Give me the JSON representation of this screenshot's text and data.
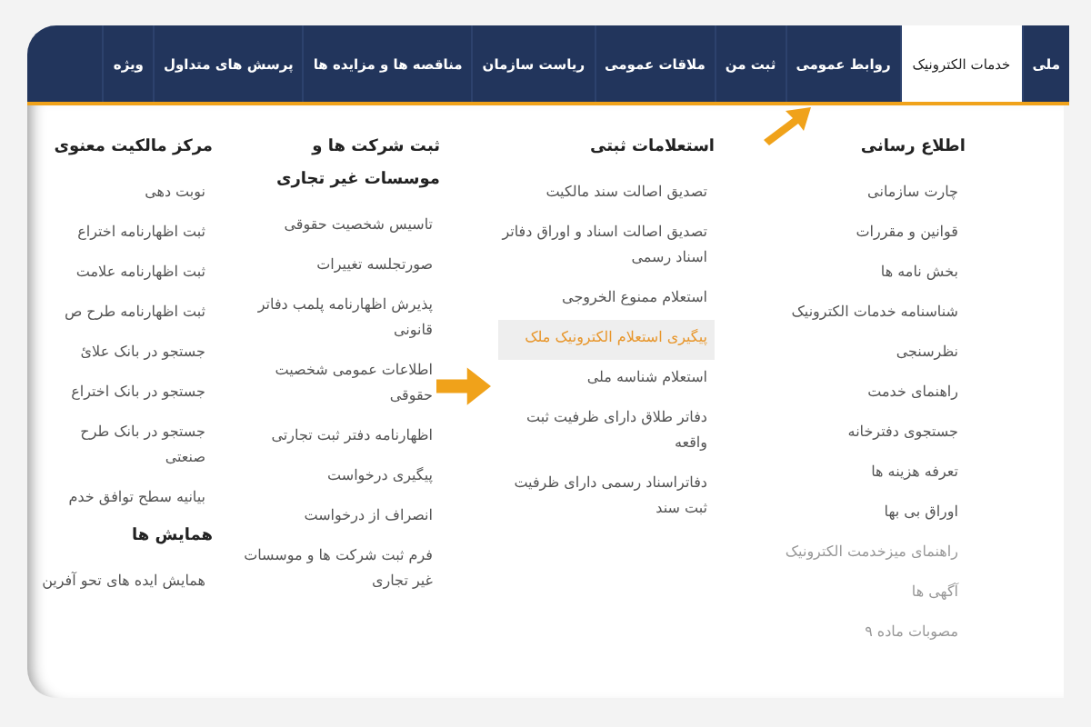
{
  "nav": {
    "items": [
      {
        "label": "ملی",
        "selected": false
      },
      {
        "label": "خدمات الکترونیک",
        "selected": true
      },
      {
        "label": "روابط عمومی",
        "selected": false
      },
      {
        "label": "ثبت من",
        "selected": false
      },
      {
        "label": "ملاقات عمومی",
        "selected": false
      },
      {
        "label": "ریاست سازمان",
        "selected": false
      },
      {
        "label": "مناقصه ها و مزایده ها",
        "selected": false
      },
      {
        "label": "پرسش های متداول",
        "selected": false
      },
      {
        "label": "ویژه",
        "selected": false
      }
    ]
  },
  "menu": {
    "columns": [
      {
        "sections": [
          {
            "heading": "اطلاع رسانی",
            "items": [
              {
                "label": "چارت سازمانی",
                "selected": false
              },
              {
                "label": "قوانین و مقررات",
                "selected": false
              },
              {
                "label": "بخش نامه ها",
                "selected": false
              },
              {
                "label": "شناسنامه خدمات الکترونیک",
                "selected": false
              },
              {
                "label": "نظرسنجی",
                "selected": false
              },
              {
                "label": "راهنمای خدمت",
                "selected": false
              },
              {
                "label": "جستجوی دفترخانه",
                "selected": false
              },
              {
                "label": "تعرفه هزینه ها",
                "selected": false
              },
              {
                "label": "اوراق بی بها",
                "selected": false
              },
              {
                "label": "راهنمای میزخدمت الکترونیک",
                "selected": false
              },
              {
                "label": "آگهی ها",
                "selected": false
              },
              {
                "label": "مصوبات ماده ۹",
                "selected": false
              }
            ]
          }
        ]
      },
      {
        "sections": [
          {
            "heading": "استعلامات ثبتی",
            "items": [
              {
                "label": "تصدیق اصالت سند مالکیت",
                "selected": false
              },
              {
                "label": "تصدیق اصالت اسناد و اوراق دفاتر اسناد رسمی",
                "selected": false
              },
              {
                "label": "استعلام ممنوع الخروجی",
                "selected": false
              },
              {
                "label": "پیگیری استعلام الکترونیک ملک",
                "selected": true
              },
              {
                "label": "استعلام شناسه ملی",
                "selected": false
              },
              {
                "label": "دفاتر طلاق دارای ظرفیت ثبت واقعه",
                "selected": false
              },
              {
                "label": "دفاتراسناد رسمی دارای ظرفیت ثبت سند",
                "selected": false
              }
            ]
          }
        ]
      },
      {
        "sections": [
          {
            "heading": "ثبت شرکت ها و موسسات غیر تجاری",
            "items": [
              {
                "label": "تاسیس شخصیت حقوقی",
                "selected": false
              },
              {
                "label": "صورتجلسه تغییرات",
                "selected": false
              },
              {
                "label": "پذیرش اظهارنامه پلمب دفاتر قانونی",
                "selected": false
              },
              {
                "label": "اطلاعات عمومی شخصیت حقوقی",
                "selected": false
              },
              {
                "label": "اظهارنامه دفتر ثبت تجارتی",
                "selected": false
              },
              {
                "label": "پیگیری درخواست",
                "selected": false
              },
              {
                "label": "انصراف از درخواست",
                "selected": false
              },
              {
                "label": "فرم ثبت شرکت ها و موسسات غیر تجاری",
                "selected": false
              }
            ]
          }
        ]
      },
      {
        "sections": [
          {
            "heading": "مرکز مالکیت معنوی",
            "items": [
              {
                "label": "نوبت دهی",
                "selected": false
              },
              {
                "label": "ثبت اظهارنامه اختراع",
                "selected": false
              },
              {
                "label": "ثبت اظهارنامه علامت",
                "selected": false
              },
              {
                "label": "ثبت اظهارنامه طرح ص",
                "selected": false
              },
              {
                "label": "جستجو در بانک علائ",
                "selected": false
              },
              {
                "label": "جستجو در بانک اختراع",
                "selected": false
              },
              {
                "label": "جستجو در بانک طرح صنعتی",
                "selected": false
              },
              {
                "label": "بیانیه سطح توافق خدم",
                "selected": false
              }
            ]
          },
          {
            "heading": "همایش ها",
            "items": [
              {
                "label": "همایش ایده های تحو آفرین",
                "selected": false
              }
            ]
          }
        ]
      }
    ]
  }
}
